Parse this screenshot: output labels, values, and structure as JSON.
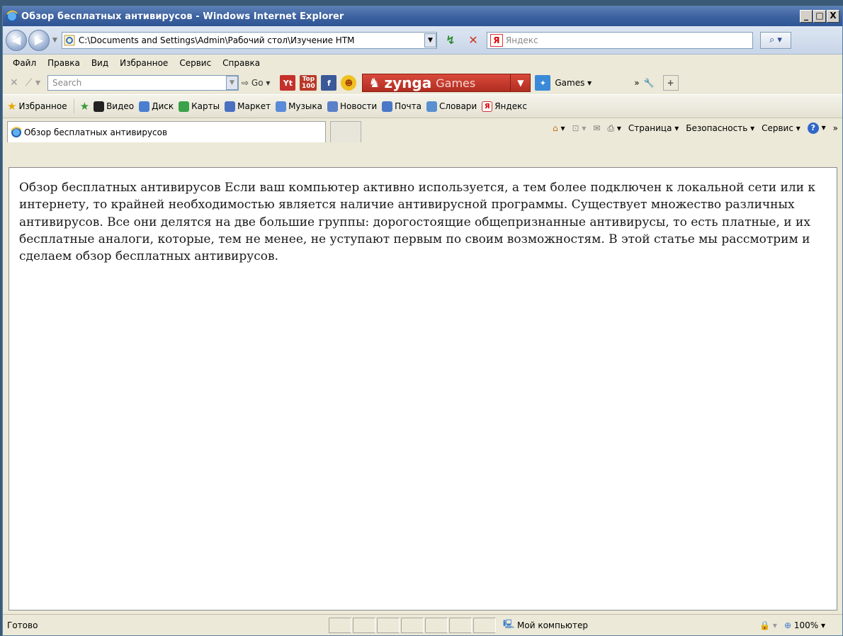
{
  "window": {
    "title": "Обзор бесплатных антивирусов - Windows Internet Explorer",
    "controls": {
      "minimize": "_",
      "maximize": "□",
      "close": "X"
    }
  },
  "address": {
    "back": "◀",
    "forward": "▶",
    "url": "C:\\Documents and Settings\\Admin\\Рабочий стол\\Изучение HTM",
    "search_placeholder": "Яндекс"
  },
  "menu": [
    "Файл",
    "Правка",
    "Вид",
    "Избранное",
    "Сервис",
    "Справка"
  ],
  "toolbar": {
    "search_placeholder": "Search",
    "go": "Go",
    "top_badge": "Top 100",
    "zynga_name": "zynga",
    "zynga_sub": "Games",
    "games": "Games"
  },
  "favorites": {
    "label": "Избранное",
    "items": [
      {
        "label": "Видео",
        "color": "#222222"
      },
      {
        "label": "Диск",
        "color": "#4a7fd0"
      },
      {
        "label": "Карты",
        "color": "#3aa24a"
      },
      {
        "label": "Маркет",
        "color": "#4a70c0"
      },
      {
        "label": "Музыка",
        "color": "#5a8ad8"
      },
      {
        "label": "Новости",
        "color": "#5a80c8"
      },
      {
        "label": "Почта",
        "color": "#4a78c8"
      },
      {
        "label": "Словари",
        "color": "#5a90d0"
      },
      {
        "label": "Яндекс",
        "color": "#d03030"
      }
    ]
  },
  "tab": {
    "title": "Обзор бесплатных антивирусов"
  },
  "command_bar": {
    "page": "Страница",
    "security": "Безопасность",
    "tools": "Сервис"
  },
  "content": {
    "text": "Обзор бесплатных антивирусов Если ваш компьютер активно используется, а тем более подключен к локальной сети или к интернету, то крайней необходимостью является наличие антивирусной программы. Существует множество различных антивирусов. Все они делятся на две большие группы: дорогостоящие общепризнанные антивирусы, то есть платные, и их бесплатные аналоги, которые, тем не менее, не уступают первым по своим возможностям. В этой статье мы рассмотрим и сделаем обзор бесплатных антивирусов."
  },
  "status": {
    "text": "Готово",
    "zone": "Мой компьютер",
    "zoom": "100%"
  }
}
